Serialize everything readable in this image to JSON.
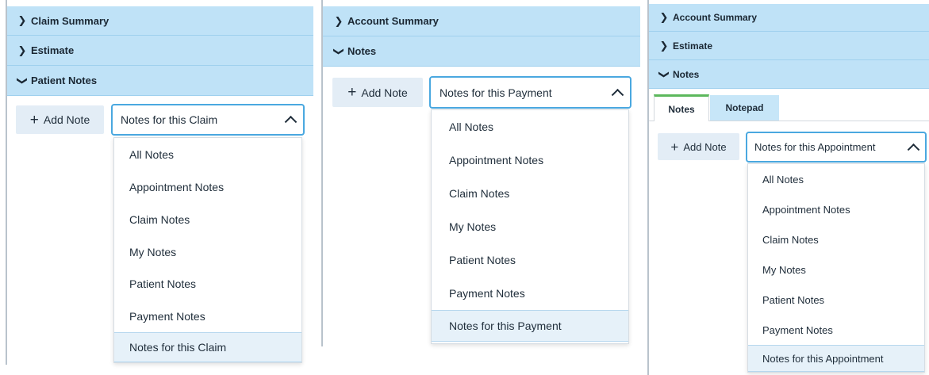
{
  "panel1": {
    "accordion": [
      {
        "chevron": "chevron-right-icon",
        "label": "Claim Summary"
      },
      {
        "chevron": "chevron-right-icon",
        "label": "Estimate"
      },
      {
        "chevron": "chevron-down-icon",
        "label": "Patient Notes"
      }
    ],
    "add_note_label": "Add Note",
    "select_value": "Notes for this Claim",
    "options": [
      "All Notes",
      "Appointment Notes",
      "Claim Notes",
      "My Notes",
      "Patient Notes",
      "Payment Notes",
      "Notes for this Claim"
    ]
  },
  "panel2": {
    "accordion": [
      {
        "chevron": "chevron-right-icon",
        "label": "Account Summary"
      },
      {
        "chevron": "chevron-down-icon",
        "label": "Notes"
      }
    ],
    "add_note_label": "Add Note",
    "select_value": "Notes for this Payment",
    "options": [
      "All Notes",
      "Appointment Notes",
      "Claim Notes",
      "My Notes",
      "Patient Notes",
      "Payment Notes",
      "Notes for this Payment"
    ]
  },
  "panel3": {
    "accordion": [
      {
        "chevron": "chevron-right-icon",
        "label": "Account Summary"
      },
      {
        "chevron": "chevron-right-icon",
        "label": "Estimate"
      },
      {
        "chevron": "chevron-down-icon",
        "label": "Notes"
      }
    ],
    "tabs": [
      "Notes",
      "Notepad"
    ],
    "add_note_label": "Add Note",
    "select_value": "Notes for this Appointment",
    "options": [
      "All Notes",
      "Appointment Notes",
      "Claim Notes",
      "My Notes",
      "Patient Notes",
      "Payment Notes",
      "Notes for this Appointment"
    ]
  },
  "colors": {
    "accordion_bg": "#bfe2f7",
    "select_border": "#4aa8e0",
    "active_tab_accent": "#5cb85c",
    "selected_option_bg": "#e6f1f9"
  },
  "icons": {
    "plus": "plus-icon",
    "caret_up": "chevron-up-icon"
  }
}
